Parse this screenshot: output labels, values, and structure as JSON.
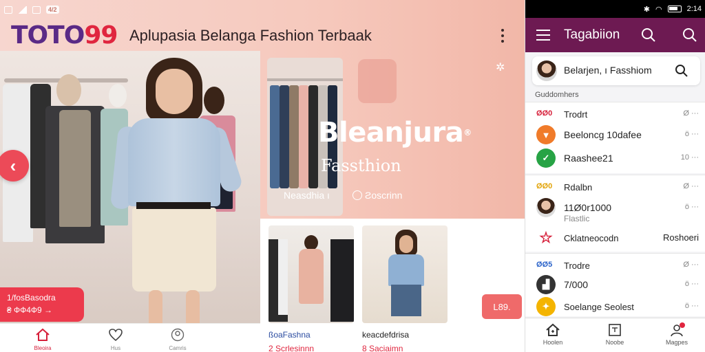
{
  "left_status": {
    "chip": "4/2"
  },
  "left_app": {
    "logo_part1": "TOTO",
    "logo_part2": "99",
    "title": "Aplupasia Belanga Fashion Terbaak",
    "hero_badge_line1": "1/fosBasodra",
    "hero_badge_line2": "₴ ФФ4Ф9 →",
    "banner_title": "Bleanjura",
    "banner_registered": "®",
    "banner_subtitle": "Fassthion",
    "banner_tag_left": "Neasdhia ı",
    "banner_tag_right": "Ƨoscrinn",
    "products": [
      {
        "label": "ßoaFashna",
        "price": "2 Scrlesinnn"
      },
      {
        "label": "keacdefdrisa",
        "price": "8 Saciaimn"
      }
    ],
    "price_chip": "L89.",
    "bottom_nav": [
      {
        "label": "Bleoira",
        "icon": "home-icon"
      },
      {
        "label": "Hus",
        "icon": "heart-icon"
      },
      {
        "label": "Camris",
        "icon": "user-icon"
      }
    ]
  },
  "right_status": {
    "time": "2:14"
  },
  "right_app": {
    "appbar_title": "Tagabiion",
    "search_text": "Belarjen, ı Fasshiom",
    "section_head": "Guddomhers",
    "groups": [
      {
        "rows": [
          {
            "icon_text": "ØØ0",
            "title": "Trodrt",
            "meta": "Ø ···"
          },
          {
            "icon": "play",
            "title": "Beeloncg 10dafee",
            "meta": "ö ···"
          },
          {
            "icon": "leaf",
            "title": "Raashee21",
            "meta": "10 ···"
          }
        ]
      },
      {
        "rows": [
          {
            "icon_text": "ØØ0",
            "title": "Rdalbn",
            "meta": "Ø ···"
          },
          {
            "icon": "avatar",
            "title": "11Ø0r1000",
            "sub": "Flastlic",
            "meta": "ö ···"
          },
          {
            "icon": "star",
            "title": "Cklatneocodn",
            "right": "Roshoeri"
          }
        ]
      },
      {
        "rows": [
          {
            "icon_text": "ØØ5",
            "title": "Trodre",
            "meta": "Ø ···"
          },
          {
            "icon": "bag",
            "title": "7/000",
            "meta": "ö ···"
          },
          {
            "icon": "bulb",
            "title": "Soelange Seolest",
            "meta": "ö ···"
          }
        ]
      }
    ],
    "bottom_nav": [
      {
        "label": "Hoolen"
      },
      {
        "label": "Noobe"
      },
      {
        "label": "Magpes"
      }
    ]
  }
}
